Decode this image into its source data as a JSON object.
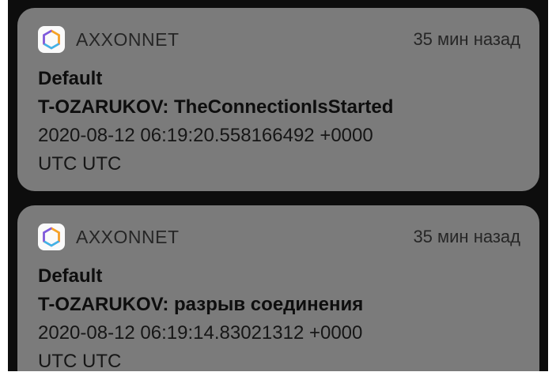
{
  "notifications": [
    {
      "app_name": "AXXONNET",
      "time": "35 мин назад",
      "title": "Default",
      "subtitle": "T-OZARUKOV: TheConnectionIsStarted",
      "message_line1": "2020-08-12 06:19:20.558166492 +0000",
      "message_line2": "UTC UTC",
      "icon": "axxonnet-hexagon-icon"
    },
    {
      "app_name": "AXXONNET",
      "time": "35 мин назад",
      "title": "Default",
      "subtitle": "T-OZARUKOV: разрыв соединения",
      "message_line1": "2020-08-12 06:19:14.83021312 +0000",
      "message_line2": "UTC UTC",
      "icon": "axxonnet-hexagon-icon"
    }
  ],
  "colors": {
    "background": "#0d0d0d",
    "card": "#7b7b7b",
    "text": "#111111"
  }
}
